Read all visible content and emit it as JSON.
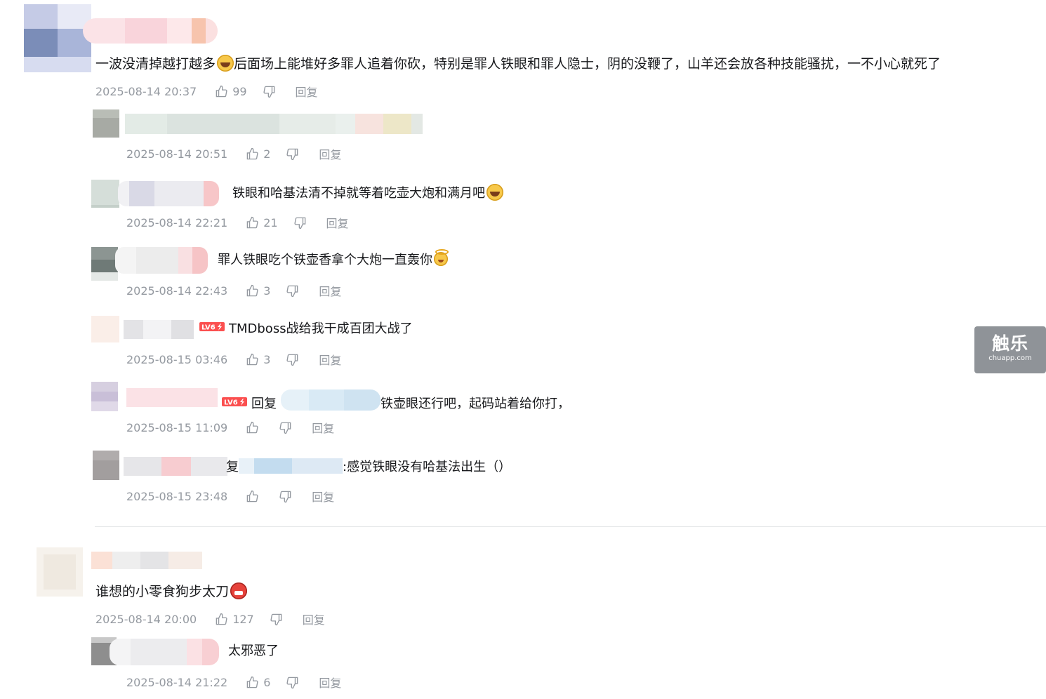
{
  "ui": {
    "reply_label": "回复",
    "watermark_main": "触乐",
    "watermark_sub": "chuapp.com",
    "like_icon": "thumbs-up-icon",
    "dislike_icon": "thumbs-down-icon"
  },
  "comments": [
    {
      "text": "一波没清掉越打越多",
      "text_after_emoji": "后面场上能堆好多罪人追着你砍，特别是罪人铁眼和罪人隐士，阴的没鞭了，山羊还会放各种技能骚扰，一不小心就死了",
      "emoji": "laughing-crying-emoji",
      "time": "2025-08-14 20:37",
      "likes": "99",
      "replies": [
        {
          "text": "",
          "time": "2025-08-14 20:51",
          "likes": "2"
        },
        {
          "text": "铁眼和哈基法清不掉就等着吃壶大炮和满月吧",
          "emoji": "laughing-crying-emoji",
          "time": "2025-08-14 22:21",
          "likes": "21"
        },
        {
          "text": "罪人铁眼吃个铁壶香拿个大炮一直轰你",
          "emoji": "angel-emoji",
          "time": "2025-08-14 22:43",
          "likes": "3"
        },
        {
          "text": "TMDboss战给我干成百团大战了",
          "badge": "LV6",
          "time": "2025-08-15 03:46",
          "likes": "3"
        },
        {
          "reply_prefix": "回复",
          "text": "铁壶眼还行吧，起码站着给你打，",
          "badge": "LV6",
          "time": "2025-08-15 11:09",
          "likes": ""
        },
        {
          "reply_prefix_partial": "复",
          "text": ":感觉铁眼没有哈基法出生（）",
          "time": "2025-08-15 23:48",
          "likes": ""
        }
      ]
    },
    {
      "text": "谁想的小零食狗步太刀",
      "emoji": "angry-emoji",
      "time": "2025-08-14 20:00",
      "likes": "127",
      "replies": [
        {
          "text": "太邪恶了",
          "time": "2025-08-14 21:22",
          "likes": "6"
        }
      ]
    }
  ],
  "colors": {
    "meta_gray": "#9499a0",
    "text": "#18191c",
    "divider": "#e3e5e7",
    "badge_red": "#fb4f4f"
  }
}
